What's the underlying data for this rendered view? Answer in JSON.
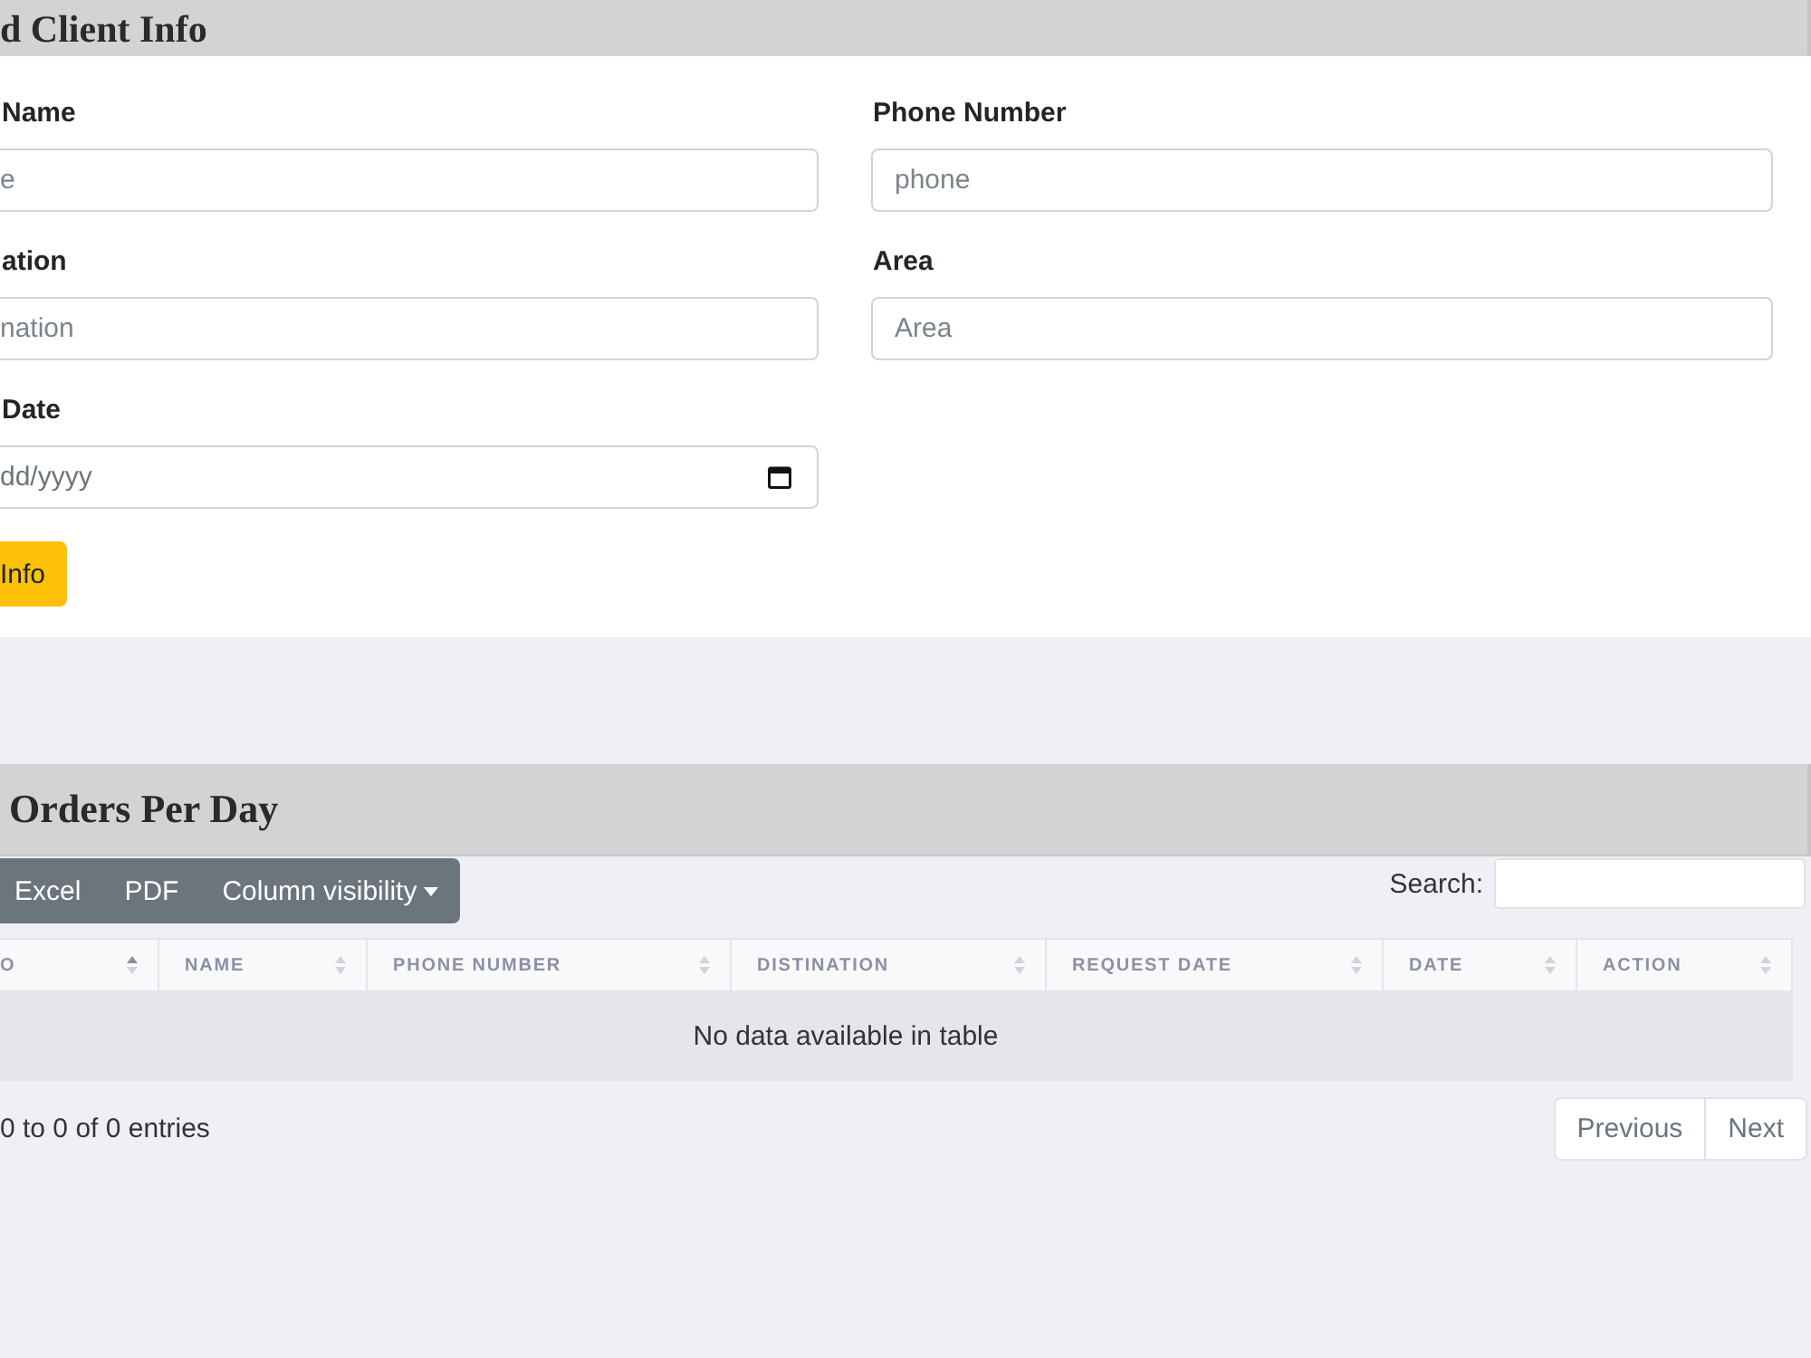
{
  "client_info_card": {
    "title": "d Client Info",
    "fields": [
      {
        "label": "Name",
        "placeholder": "e",
        "kind": "text"
      },
      {
        "label": "Phone Number",
        "placeholder": "phone",
        "kind": "text"
      },
      {
        "label": "ation",
        "placeholder": "nation",
        "kind": "text"
      },
      {
        "label": "Area",
        "placeholder": "Area",
        "kind": "text"
      },
      {
        "label": "Date",
        "placeholder": "dd/yyyy",
        "kind": "date"
      }
    ],
    "submit_button": "Info"
  },
  "orders_card": {
    "title": "Orders Per Day",
    "export_buttons": [
      {
        "label": "Excel",
        "kind": "plain"
      },
      {
        "label": "PDF",
        "kind": "plain"
      },
      {
        "label": "Column visibility",
        "kind": "dropdown"
      }
    ],
    "search": {
      "label": "Search:"
    },
    "table": {
      "columns": [
        {
          "label": "O",
          "sorted": true
        },
        {
          "label": "NAME",
          "sorted": false
        },
        {
          "label": "PHONE NUMBER",
          "sorted": false
        },
        {
          "label": "DISTINATION",
          "sorted": false
        },
        {
          "label": "REQUEST DATE",
          "sorted": false
        },
        {
          "label": "DATE",
          "sorted": false
        },
        {
          "label": "ACTION",
          "sorted": false
        }
      ],
      "empty_message": "No data available in table"
    },
    "info": "0 to 0 of 0 entries",
    "pagination": [
      "Previous",
      "Next"
    ]
  }
}
